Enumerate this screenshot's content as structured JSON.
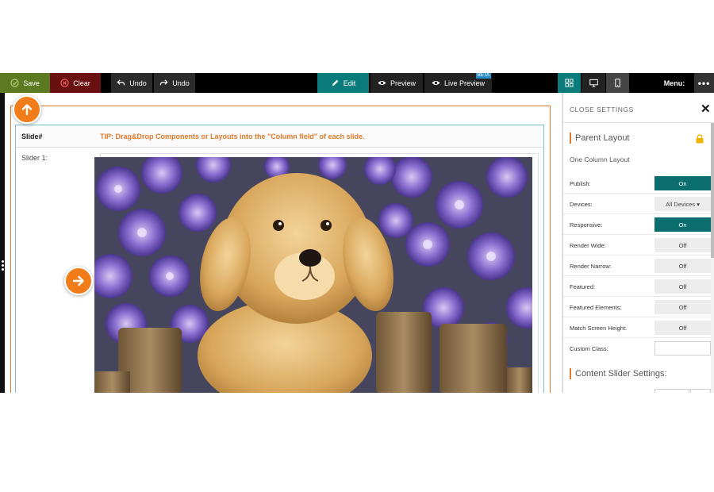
{
  "toolbar": {
    "save": "Save",
    "clear": "Clear",
    "undo": "Undo",
    "redo": "Undo",
    "edit": "Edit",
    "preview": "Preview",
    "live_preview": "Live Preview",
    "beta": "BETA",
    "menu": "Menu:",
    "more": "•••"
  },
  "canvas": {
    "header_slide": "Slide#",
    "tip": "TIP: Drag&Drop Components or Layouts into the \"Column field\" of each slide.",
    "slider_label": "Slider 1:"
  },
  "panel": {
    "close_label": "CLOSE SETTINGS",
    "close_x": "✕",
    "parent_title": "Parent Layout",
    "layout_name": "One Column Layout",
    "rows": [
      {
        "label": "Publish:",
        "value": "On",
        "state": "on"
      },
      {
        "label": "Devices:",
        "value": "All Devices ▾",
        "state": "off"
      },
      {
        "label": "Responsive:",
        "value": "On",
        "state": "on"
      },
      {
        "label": "Render Wide:",
        "value": "Off",
        "state": "off"
      },
      {
        "label": "Render Narrow:",
        "value": "Off",
        "state": "off"
      },
      {
        "label": "Featured:",
        "value": "Off",
        "state": "off"
      },
      {
        "label": "Featured Elements:",
        "value": "Off",
        "state": "off"
      },
      {
        "label": "Match Screen Height:",
        "value": "Off",
        "state": "off"
      },
      {
        "label": "Custom Class:",
        "value": "",
        "state": "input"
      }
    ],
    "content_title": "Content Slider Settings:"
  },
  "colors": {
    "accent_teal": "#0b7b7b",
    "accent_orange": "#f07d1a",
    "save_green": "#5c7a1f",
    "clear_red": "#6a1010"
  }
}
